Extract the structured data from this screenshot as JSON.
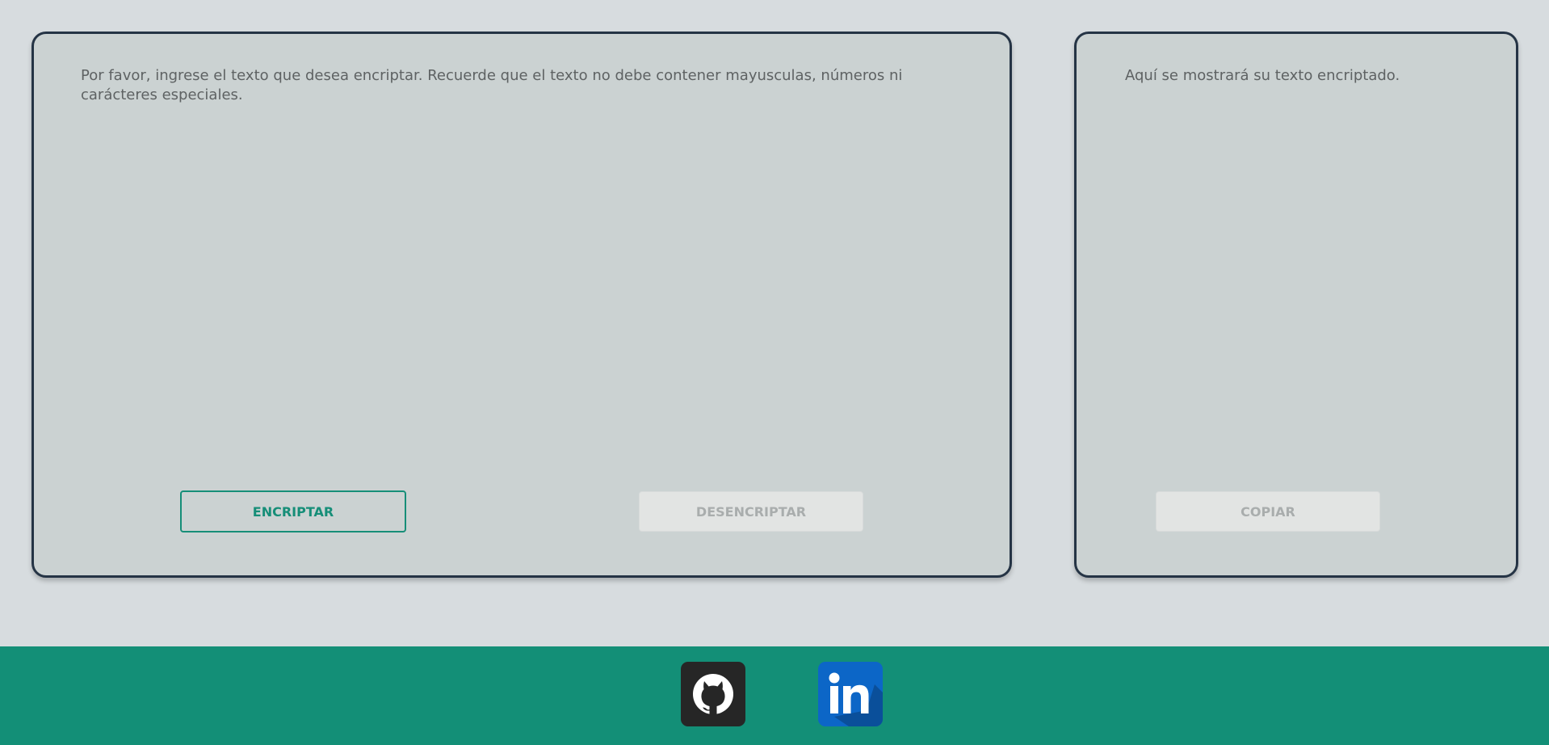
{
  "input": {
    "placeholder": "Por favor, ingrese el texto que desea encriptar. Recuerde que el texto no debe contener mayusculas, números ni carácteres especiales.",
    "value": ""
  },
  "buttons": {
    "encrypt_label": "ENCRIPTAR",
    "decrypt_label": "DESENCRIPTAR",
    "copy_label": "COPIAR"
  },
  "output": {
    "text": "Aquí se mostrará su texto encriptado."
  },
  "footer": {
    "links": [
      {
        "name": "github",
        "icon": "github-icon"
      },
      {
        "name": "linkedin",
        "icon": "linkedin-icon"
      }
    ]
  },
  "colors": {
    "accent": "#138f77",
    "panel_border": "#253445",
    "panel_background": "#cbd2d2",
    "page_background": "#d7dcdf"
  }
}
